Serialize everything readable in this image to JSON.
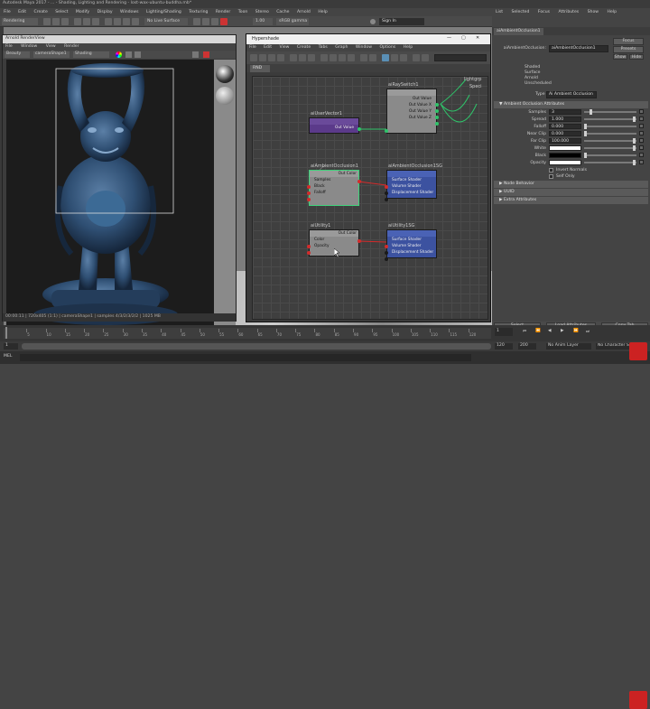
{
  "app": {
    "title": "Autodesk Maya 2017 - ... - Shading, Lighting and Rendering - lost-wax-ubuntu-buddha.mb*",
    "mode": "Rendering",
    "menus": [
      "File",
      "Edit",
      "Create",
      "Select",
      "Modify",
      "Display",
      "Windows",
      "Lighting/Shading",
      "Texturing",
      "Render",
      "Toon",
      "Stereo",
      "Cache",
      "Arnold",
      "Help"
    ],
    "no_live_surface": "No Live Surface",
    "zoom_val": "1.00",
    "colorspace": "sRGB gamma",
    "sign_in": "Sign In",
    "right_menus": [
      "List",
      "Selected",
      "Focus",
      "Attributes",
      "Show",
      "Help"
    ]
  },
  "render_view": {
    "title": "Arnold RenderView",
    "menus": [
      "File",
      "Window",
      "View",
      "Render"
    ],
    "mode": "Beauty",
    "camera": "cameraShape1",
    "shading": "Shading",
    "status": "00:00:11 | 720x405 (1:1) | cameraShape1 | samples 4/3/2/3/2/2 | 1025 MB"
  },
  "hypershade": {
    "title": "Hypershade",
    "menus": [
      "File",
      "Edit",
      "View",
      "Create",
      "Tabs",
      "Graph",
      "Window",
      "Options",
      "Help"
    ],
    "tab": "RND",
    "nodes": {
      "layered": {
        "title": "aiRaySwitch1",
        "in": "aiUserVector1",
        "out": "Out Color",
        "rows": [
          "Out Value",
          "Out Value X",
          "Out Value Y",
          "Out Value Z"
        ]
      },
      "input": {
        "title": "aiUserVector1",
        "rows": [
          "Out Value"
        ]
      },
      "occl": {
        "title": "aiAmbientOcclusion1",
        "out": "Out Color",
        "rows": [
          "Samples",
          "Black",
          "Falloff"
        ]
      },
      "sg1": {
        "title": "aiAmbientOcclusion1SG",
        "rows": [
          "Surface Shader",
          "Volume Shader",
          "Displacement Shader"
        ]
      },
      "util": {
        "title": "aiUtility1",
        "out": "Out Color",
        "rows": [
          "Color",
          "Opacity"
        ]
      },
      "sg2": {
        "title": "aiUtility1SG",
        "rows": [
          "Surface Shader",
          "Volume Shader",
          "Displacement Shader"
        ]
      }
    },
    "ghost_label": "lightgrp",
    "ghost_label2": "Speci"
  },
  "attribute_editor": {
    "tab": "aiAmbientOcclusion1",
    "node_label": "aiAmbientOcclusion:",
    "node_value": "aiAmbientOcclusion1",
    "focus": "Focus",
    "presets": "Presets",
    "show": "Show",
    "hide": "Hide",
    "assigned": [
      "Shaded",
      "Surface",
      "Arnold",
      "Unscheduled"
    ],
    "type_label": "Type",
    "type_value": "Ai Ambient Occlusion",
    "section_main": "Ambient Occlusion Attributes",
    "attrs": [
      {
        "label": "Samples",
        "value": "3"
      },
      {
        "label": "Spread",
        "value": "1.000"
      },
      {
        "label": "Falloff",
        "value": "0.000"
      },
      {
        "label": "Near Clip",
        "value": "0.000"
      },
      {
        "label": "Far Clip",
        "value": "100.000"
      },
      {
        "label": "White",
        "value": ""
      },
      {
        "label": "Black",
        "value": ""
      },
      {
        "label": "Opacity",
        "value": ""
      }
    ],
    "checks": [
      "Invert Normals",
      "Self Only"
    ],
    "sections": [
      "Node Behavior",
      "UUID",
      "Extra Attributes"
    ],
    "bottom": [
      "Select",
      "Load Attributes",
      "Copy Tab"
    ]
  },
  "timeline": {
    "ticks": [
      "5",
      "10",
      "15",
      "20",
      "25",
      "30",
      "35",
      "40",
      "45",
      "50",
      "55",
      "60",
      "65",
      "70",
      "75",
      "80",
      "85",
      "90",
      "95",
      "100",
      "105",
      "110",
      "115",
      "120"
    ],
    "current": "1",
    "start": "1",
    "end": "120",
    "range_end": "120",
    "anim_end": "200",
    "no_anim": "No Anim Layer",
    "no_char": "No Character Set",
    "cmd_lang": "MEL"
  },
  "colors": {
    "accent": "#5a8fb5",
    "select": "#3fd17a",
    "node_purple": "#5b3a8a",
    "node_blue": "#3c52a0",
    "node_grey": "#8a8a8a"
  }
}
